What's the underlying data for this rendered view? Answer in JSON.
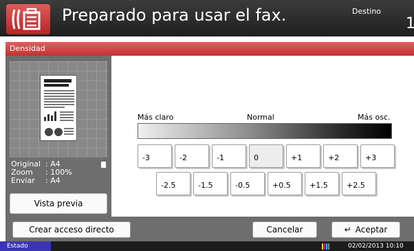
{
  "header": {
    "title": "Preparado para usar el fax.",
    "destination_label": "Destino",
    "destination_count": "1"
  },
  "section": {
    "title": "Densidad"
  },
  "preview": {
    "info": [
      {
        "key": "Original",
        "value": ": A4"
      },
      {
        "key": "Zoom",
        "value": ": 100%"
      },
      {
        "key": "Enviar",
        "value": ": A4"
      }
    ],
    "preview_button": "Vista previa"
  },
  "density": {
    "light_label": "Más claro",
    "normal_label": "Normal",
    "dark_label": "Más osc.",
    "row1": [
      "-3",
      "-2",
      "-1",
      "0",
      "+1",
      "+2",
      "+3"
    ],
    "row2": [
      "-2.5",
      "-1.5",
      "-0.5",
      "+0.5",
      "+1.5",
      "+2.5"
    ],
    "selected": "0"
  },
  "bottom": {
    "shortcut_button": "Crear acceso directo",
    "cancel_button": "Cancelar",
    "accept_button": "Aceptar"
  },
  "status": {
    "label": "Estado",
    "datetime": "02/02/2013  10:10"
  },
  "colors": {
    "header_bg": "#2a2a2a",
    "section_red": "#d04848",
    "status_blue": "#3b35b3"
  }
}
